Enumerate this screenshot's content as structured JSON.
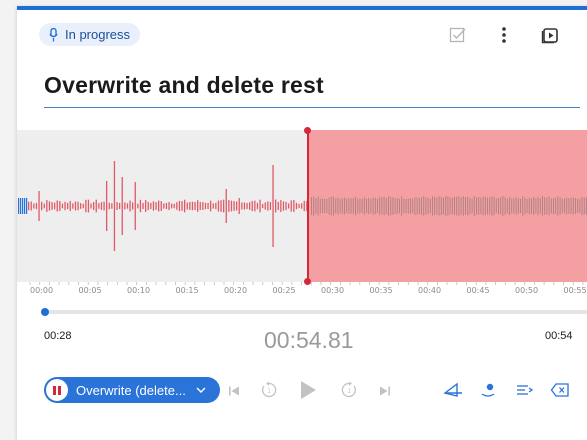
{
  "status": {
    "label": "In progress",
    "icon": "microphone-icon"
  },
  "toolbar": {
    "icons": [
      "check-box-icon",
      "more-vertical-icon",
      "play-preview-icon",
      "close-icon"
    ]
  },
  "title": "Overwrite and delete rest",
  "waveform": {
    "played_color": "#e05a66",
    "remaining_color": "#7a6b6c",
    "region_color": "#f4a0a3",
    "playhead_color": "#d3283a"
  },
  "timeline": {
    "ticks": [
      "00:00",
      "00:05",
      "00:10",
      "00:15",
      "00:20",
      "00:25",
      "00:30",
      "00:35",
      "00:40",
      "00:45",
      "00:50",
      "00:55"
    ]
  },
  "scrubber": {
    "position_fraction": 0.0
  },
  "times": {
    "current": "00:28",
    "total_display": "00:54.81",
    "end": "00:54"
  },
  "mode": {
    "label": "Overwrite (delete..."
  },
  "accent": "#2a73d9"
}
